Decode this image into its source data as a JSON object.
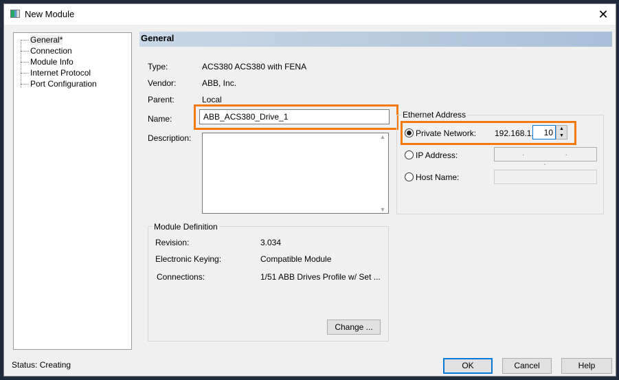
{
  "window": {
    "title": "New Module",
    "close_icon": "close-icon"
  },
  "tree": {
    "items": [
      {
        "label": "General*"
      },
      {
        "label": "Connection"
      },
      {
        "label": "Module Info"
      },
      {
        "label": "Internet Protocol"
      },
      {
        "label": "Port Configuration"
      }
    ]
  },
  "section": {
    "title": "General"
  },
  "fields": {
    "type_label": "Type:",
    "type_value": "ACS380 ACS380 with FENA",
    "vendor_label": "Vendor:",
    "vendor_value": "ABB, Inc.",
    "parent_label": "Parent:",
    "parent_value": "Local",
    "name_label": "Name:",
    "name_value": "ABB_ACS380_Drive_1",
    "description_label": "Description:",
    "description_value": ""
  },
  "ethernet": {
    "group_title": "Ethernet Address",
    "private_network_label": "Private Network:",
    "private_prefix": "192.168.1.",
    "private_value": "10",
    "private_selected": true,
    "ip_address_label": "IP Address:",
    "ip_value": ". . .",
    "host_name_label": "Host Name:",
    "host_value": ""
  },
  "module_definition": {
    "group_title": "Module Definition",
    "revision_label": "Revision:",
    "revision_value": "3.034",
    "keying_label": "Electronic Keying:",
    "keying_value": "Compatible Module",
    "connections_label": "Connections:",
    "connections_value": "1/51 ABB Drives Profile w/ Set ...",
    "change_button": "Change ..."
  },
  "status": {
    "text": "Status:  Creating"
  },
  "buttons": {
    "ok": "OK",
    "cancel": "Cancel",
    "help": "Help"
  },
  "colors": {
    "highlight": "#f47a10",
    "header": "#b8cce0"
  }
}
